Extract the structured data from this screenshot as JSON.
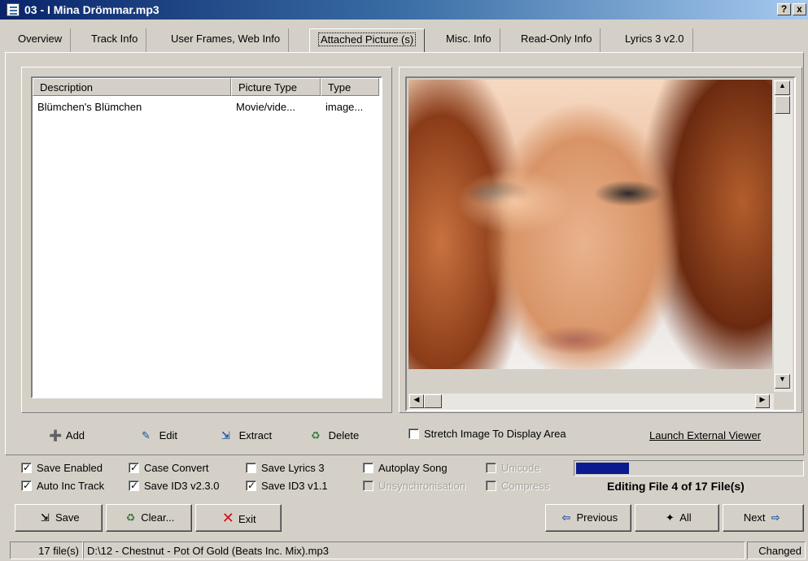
{
  "window": {
    "title": "03 - I Mina Drömmar.mp3",
    "help_button": "?",
    "close_button": "x"
  },
  "tabs": [
    {
      "label": "Overview"
    },
    {
      "label": "Track Info"
    },
    {
      "label": "User Frames, Web Info"
    },
    {
      "label": "Attached Picture (s)",
      "active": true
    },
    {
      "label": "Misc. Info"
    },
    {
      "label": "Read-Only Info"
    },
    {
      "label": "Lyrics 3 v2.0"
    }
  ],
  "picture_list": {
    "columns": [
      "Description",
      "Picture Type",
      "Type"
    ],
    "rows": [
      {
        "description": "Blümchen's Blümchen",
        "picture_type": "Movie/vide...",
        "type": "image..."
      }
    ]
  },
  "list_actions": {
    "add": "Add",
    "edit": "Edit",
    "extract": "Extract",
    "delete": "Delete"
  },
  "preview": {
    "stretch_label": "Stretch Image To Display Area",
    "stretch_checked": false,
    "launch_viewer": "Launch External Viewer"
  },
  "options": {
    "save_enabled": "Save Enabled",
    "case_convert": "Case Convert",
    "save_lyrics3": "Save Lyrics 3",
    "autoplay_song": "Autoplay Song",
    "unicode": "Unicode",
    "auto_inc_track": "Auto Inc Track",
    "save_id3_v230": "Save ID3 v2.3.0",
    "save_id3_v11": "Save ID3 v1.1",
    "unsynchronisation": "Unsynchronisation",
    "compress": "Compress"
  },
  "progress": {
    "fraction": 0.235,
    "status_text": "Editing File 4 of 17 File(s)"
  },
  "bottom_buttons": {
    "save": "Save",
    "clear": "Clear...",
    "exit": "Exit",
    "previous": "Previous",
    "all": "All",
    "next": "Next"
  },
  "statusbar": {
    "count": "17 file(s)",
    "path": "D:\\12 - Chestnut - Pot Of Gold (Beats Inc. Mix).mp3",
    "state": "Changed"
  },
  "colors": {
    "face": "#d4d0c8",
    "title_start": "#0a246a",
    "progress": "#0a1a8f",
    "icon_blue": "#1a4fa3"
  },
  "icons": [
    "document-icon",
    "add-icon",
    "edit-icon",
    "extract-icon",
    "delete-icon",
    "save-disk-icon",
    "clear-icon",
    "exit-x-icon",
    "left-arrow-icon",
    "all-icon",
    "right-arrow-icon"
  ]
}
